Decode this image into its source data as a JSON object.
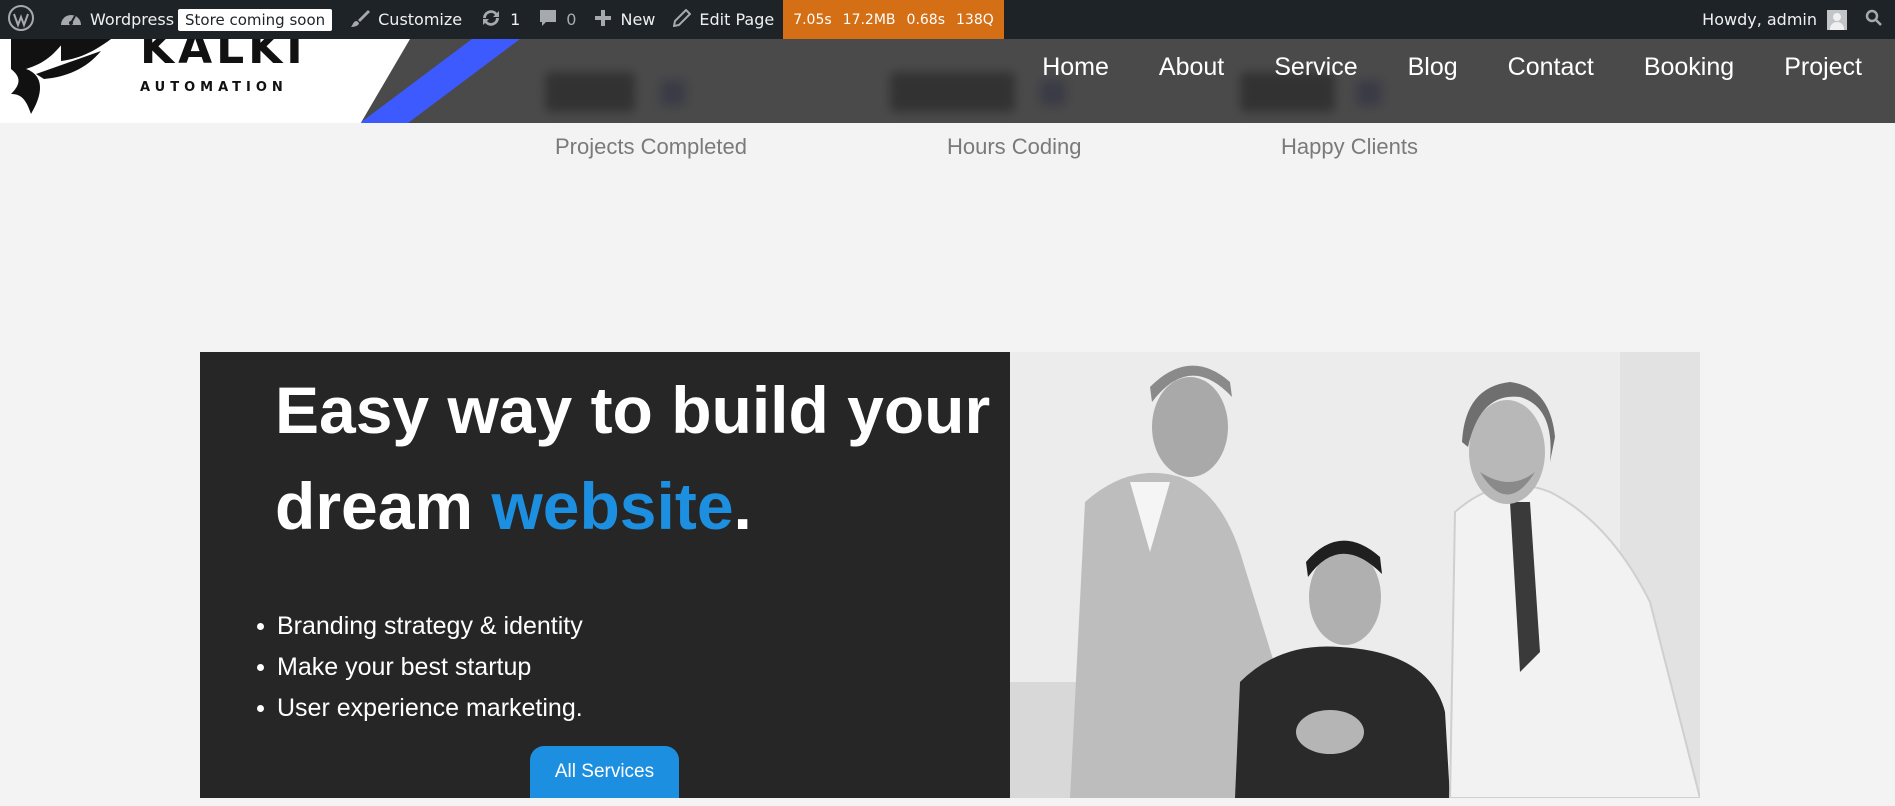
{
  "adminbar": {
    "site_name": "Wordpress",
    "store_badge": "Store coming soon",
    "customize": "Customize",
    "updates_count": "1",
    "comments_count": "0",
    "new_label": "New",
    "edit_page": "Edit Page",
    "perf": {
      "time": "7.05s",
      "memory": "17.2MB",
      "query_time": "0.68s",
      "queries": "138Q"
    },
    "howdy": "Howdy, admin"
  },
  "header": {
    "logo_text": "KALKI",
    "logo_subtext": "AUTOMATION",
    "accent_color": "#3d5afe",
    "nav": [
      "Home",
      "About",
      "Service",
      "Blog",
      "Contact",
      "Booking",
      "Project"
    ]
  },
  "stats": {
    "labels": [
      "Projects Completed",
      "Hours Coding",
      "Happy Clients"
    ]
  },
  "hero": {
    "title_line1": "Easy way to build your",
    "title_line2_start": "dream ",
    "title_accent": "website",
    "title_end": ".",
    "accent_color": "#1c8fe0",
    "bullets": [
      "Branding strategy & identity",
      "Make your best startup",
      "User experience marketing."
    ],
    "button_label": "All Services",
    "photo_icon": "team-photo"
  }
}
